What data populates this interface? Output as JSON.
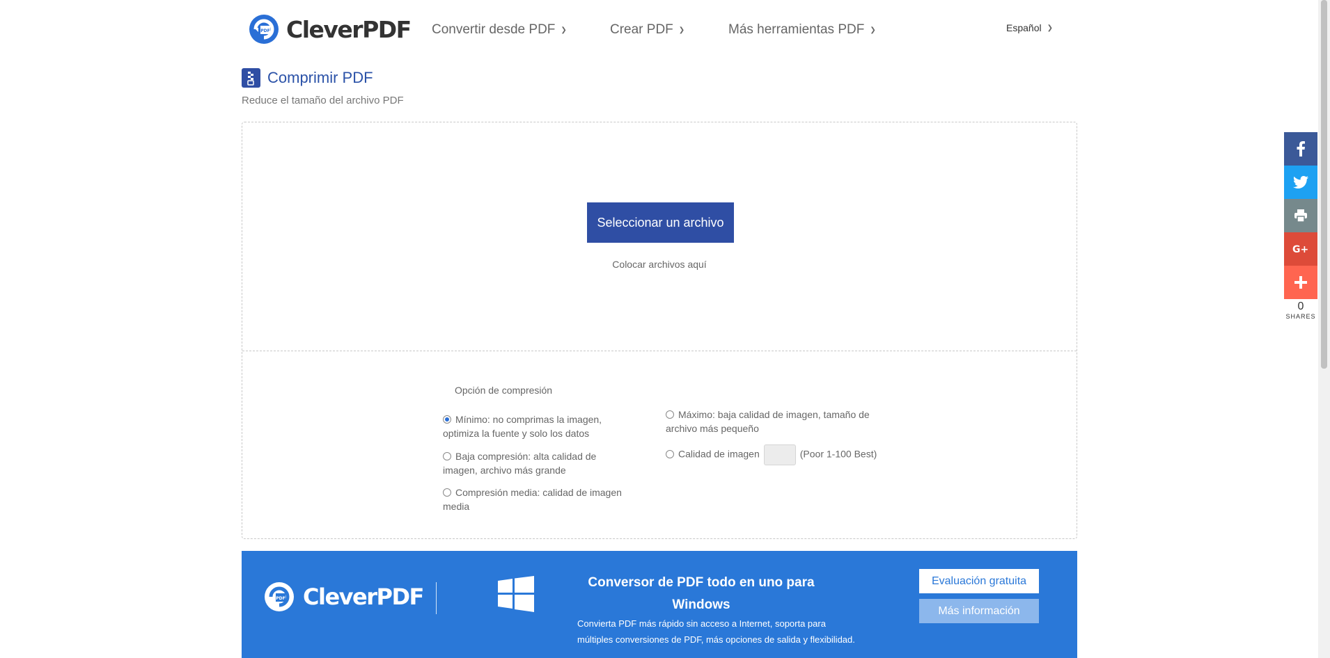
{
  "header": {
    "logo_text": "CleverPDF",
    "nav": [
      {
        "label": "Convertir desde PDF"
      },
      {
        "label": "Crear PDF"
      },
      {
        "label": "Más herramientas PDF"
      }
    ],
    "language": "Español"
  },
  "page": {
    "title": "Comprimir PDF",
    "subtitle": "Reduce el tamaño del archivo PDF"
  },
  "upload": {
    "select_label": "Seleccionar un archivo",
    "drop_text": "Colocar archivos aquí"
  },
  "options": {
    "title": "Opción de compresión",
    "items": [
      {
        "label": "Mínimo: no comprimas la imagen, optimiza la fuente y solo los datos",
        "checked": true
      },
      {
        "label": "Baja compresión: alta calidad de imagen, archivo más grande",
        "checked": false
      },
      {
        "label": "Compresión media: calidad de imagen media",
        "checked": false
      },
      {
        "label": "Máximo: baja calidad de imagen, tamaño de archivo más pequeño",
        "checked": false
      },
      {
        "label": "Calidad de imagen",
        "checked": false,
        "hint": "(Poor 1-100 Best)"
      }
    ]
  },
  "banner": {
    "logo_text": "CleverPDF",
    "title": "Conversor de PDF todo en uno para Windows",
    "description": "Convierta PDF más rápido sin acceso a Internet, soporta para múltiples conversiones de PDF, más opciones de salida y flexibilidad.",
    "trial_button": "Evaluación gratuita",
    "info_button": "Más información"
  },
  "share": {
    "count": "0",
    "label": "SHARES",
    "buttons": [
      {
        "name": "facebook",
        "color": "#3b5998"
      },
      {
        "name": "twitter",
        "color": "#1da1f2"
      },
      {
        "name": "print",
        "color": "#76898c"
      },
      {
        "name": "google-plus",
        "color": "#dd4b39"
      },
      {
        "name": "more",
        "color": "#ff6550"
      }
    ]
  },
  "colors": {
    "brand_blue": "#2f4ea4",
    "banner_blue": "#2a78d8"
  }
}
